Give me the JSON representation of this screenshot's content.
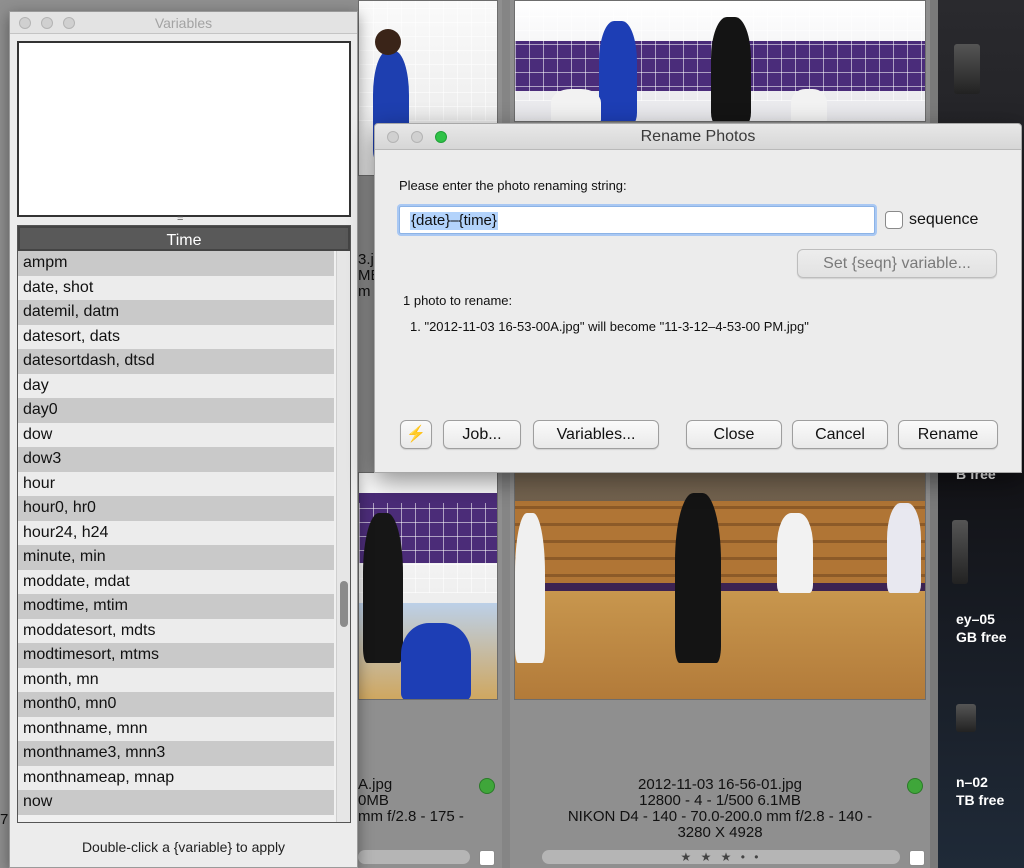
{
  "variables_panel": {
    "title": "Variables",
    "list_header": "Time",
    "items": [
      "ampm",
      "date, shot",
      "datemil, datm",
      "datesort, dats",
      "datesortdash, dtsd",
      "day",
      "day0",
      "dow",
      "dow3",
      "hour",
      "hour0, hr0",
      "hour24, h24",
      "minute, min",
      "moddate, mdat",
      "modtime, mtim",
      "moddatesort, mdts",
      "modtimesort, mtms",
      "month, mn",
      "month0, mn0",
      "monthname, mnn",
      "monthname3, mnn3",
      "monthnameap, mnap",
      "now"
    ],
    "hint": "Double-click a {variable} to apply"
  },
  "rename_dialog": {
    "title": "Rename Photos",
    "prompt": "Please enter the photo renaming string:",
    "rename_string": "{date}–{time}",
    "sequence_label": "sequence",
    "set_seqn_label": "Set {seqn} variable...",
    "count_text": "1 photo to rename:",
    "detail_text": "1.  \"2012-11-03 16-53-00A.jpg\" will become \"11-3-12–4-53-00 PM.jpg\"",
    "buttons": {
      "lightning": "⚡",
      "job": "Job...",
      "variables": "Variables...",
      "close": "Close",
      "cancel": "Cancel",
      "rename": "Rename"
    }
  },
  "background": {
    "left_caption": [
      "3.jpg",
      "MB",
      "m f"
    ],
    "mid_caption": [
      "A.jpg",
      "0MB",
      "mm f/2.8 - 175 -"
    ],
    "right_caption": [
      "2012-11-03 16-56-01.jpg",
      "12800 - 4 - 1/500 6.1MB",
      "NIKON D4 - 140 - 70.0-200.0 mm f/2.8 - 140 -",
      "3280 X 4928"
    ],
    "rating": "★ ★ ★  •  •",
    "right_sidebar": [
      "B free",
      "ey–05",
      "GB free",
      "n–02",
      "TB free"
    ],
    "far_left_caption": "7"
  },
  "colors": {
    "accent": "#2fc247",
    "selection": "#b3d3fb",
    "status_green": "#3fa63a"
  }
}
